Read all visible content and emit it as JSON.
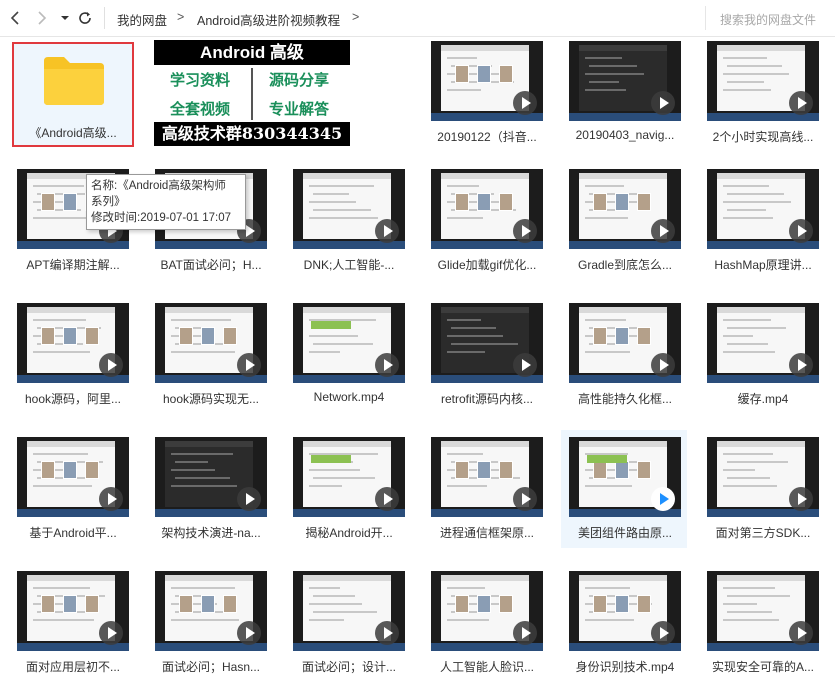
{
  "nav": {
    "back_icon": "chevron-left-icon",
    "forward_icon": "chevron-right-icon",
    "dropdown_icon": "caret-down-icon",
    "refresh_icon": "refresh-icon",
    "breadcrumb": [
      "我的网盘",
      "Android高级进阶视频教程"
    ],
    "separator": ">",
    "search_placeholder": "搜索我的网盘文件"
  },
  "folder": {
    "name": "《Android高级...",
    "icon": "folder-icon",
    "color": "#f7c325"
  },
  "promo": {
    "header": "Android 高级",
    "cells": [
      "学习资料",
      "源码分享",
      "全套视频",
      "专业解答"
    ],
    "footer": "高级技术群830344345"
  },
  "tooltip": {
    "name_line": "名称:《Android高级架构师",
    "name_line2": "系列》",
    "time_line": "修改时间:2019-07-01 17:07"
  },
  "files": [
    {
      "label": "20190122（抖音..."
    },
    {
      "label": "20190403_navig..."
    },
    {
      "label": "2个小时实现高线..."
    },
    {
      "label": "APT编译期注解..."
    },
    {
      "label": "BAT面试必问；H..."
    },
    {
      "label": "DNK;人工智能-..."
    },
    {
      "label": "Glide加载gif优化..."
    },
    {
      "label": "Gradle到底怎么..."
    },
    {
      "label": "HashMap原理讲..."
    },
    {
      "label": "hook源码，阿里..."
    },
    {
      "label": "hook源码实现无..."
    },
    {
      "label": "Network.mp4"
    },
    {
      "label": "retrofit源码内核..."
    },
    {
      "label": "高性能持久化框..."
    },
    {
      "label": "缓存.mp4"
    },
    {
      "label": "基于Android平..."
    },
    {
      "label": "架构技术演进-na..."
    },
    {
      "label": "揭秘Android开..."
    },
    {
      "label": "进程通信框架原..."
    },
    {
      "label": "美团组件路由原..."
    },
    {
      "label": "面对第三方SDK..."
    },
    {
      "label": "面对应用层初不..."
    },
    {
      "label": "面试必问；Hasn..."
    },
    {
      "label": "面试必问；设计..."
    },
    {
      "label": "人工智能人脸识..."
    },
    {
      "label": "身份识别技术.mp4"
    },
    {
      "label": "实现安全可靠的A..."
    }
  ],
  "colors": {
    "selection_border": "#e0393e",
    "play_highlight": "#1e90ff"
  }
}
